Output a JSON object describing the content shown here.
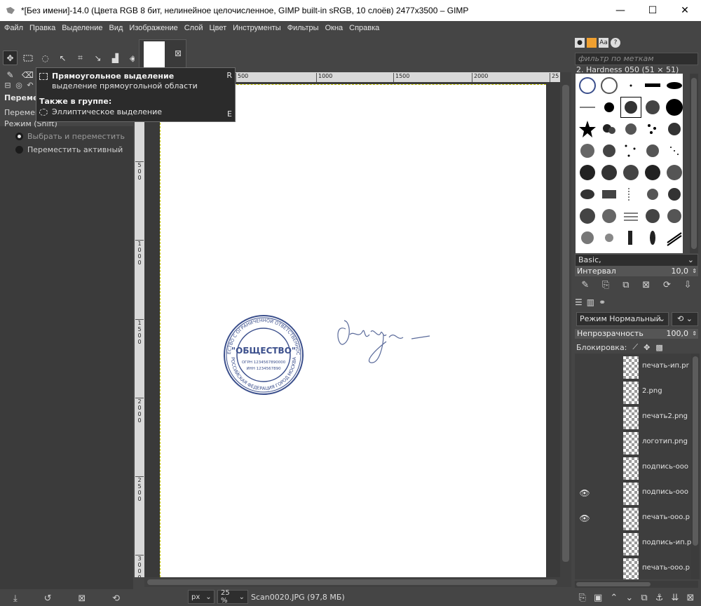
{
  "window": {
    "title": "*[Без имени]-14.0 (Цвета RGB 8 бит, нелинейное целочисленное, GIMP built-in sRGB, 10 слоёв) 2477x3500 – GIMP",
    "minimize": "—",
    "maximize": "☐",
    "close": "✕"
  },
  "menu": [
    "Файл",
    "Правка",
    "Выделение",
    "Вид",
    "Изображение",
    "Слой",
    "Цвет",
    "Инструменты",
    "Фильтры",
    "Окна",
    "Справка"
  ],
  "tooltip": {
    "tool_name": "Прямоугольное выделение",
    "tool_key": "R",
    "tool_desc": "выделение прямоугольной области",
    "group_label": "Также в группе:",
    "alt_tool": "Эллиптическое выделение",
    "alt_key": "E"
  },
  "tool_options": {
    "title": "Перемещение",
    "move_label": "Перемещение:",
    "mode_label": "Режим (Shift)",
    "radio1": "Выбрать и переместить",
    "radio2": "Переместить активный"
  },
  "ruler": {
    "h_ticks": [
      "500",
      "1000",
      "1500",
      "2000",
      "25"
    ],
    "v_ticks": [
      "5\n0\n0",
      "1\n0\n0\n0",
      "1\n5\n0\n0",
      "2\n0\n0\n0",
      "2\n5\n0\n0",
      "3\n0\n0\n0"
    ]
  },
  "document": {
    "stamp_top_text": "ОБЩЕСТВО С ОГРАНИЧЕННОЙ ОТВЕТСТВЕННОСТЬЮ",
    "stamp_bottom_text": "РОССИЙСКАЯ ФЕДЕРАЦИЯ ГОРОД МОСКВА",
    "stamp_main": "\"ОБЩЕСТВО\"",
    "stamp_ogrn": "ОГРН 1234567890000",
    "stamp_inn": "ИНН 1234567890"
  },
  "status": {
    "unit": "px",
    "zoom": "25 %",
    "file": "Scan0020.JPG (97,8 МБ)"
  },
  "brushes": {
    "filter_placeholder": "фильтр по меткам",
    "current": "2. Hardness 050 (51 × 51)",
    "preset": "Basic,",
    "spacing_label": "Интервал",
    "spacing_value": "10,0"
  },
  "layers": {
    "mode_label": "Режим",
    "mode_value": "Нормальный",
    "opacity_label": "Непрозрачность",
    "opacity_value": "100,0",
    "lock_label": "Блокировка:",
    "items": [
      {
        "name": "печать-ип.pr",
        "visible": false
      },
      {
        "name": "2.png",
        "visible": false
      },
      {
        "name": "печать2.png",
        "visible": false
      },
      {
        "name": "логотип.png",
        "visible": false
      },
      {
        "name": "подпись-ооо",
        "visible": false
      },
      {
        "name": "подпись-ооо",
        "visible": true
      },
      {
        "name": "печать-ооо.р",
        "visible": true
      },
      {
        "name": "подпись-ип.р",
        "visible": false
      },
      {
        "name": "печать-ооо.р",
        "visible": false
      }
    ]
  },
  "colors": {
    "accent": "#f0a030",
    "stamp_ink": "#3b4f8c",
    "signature_ink": "#5a6a9a"
  }
}
